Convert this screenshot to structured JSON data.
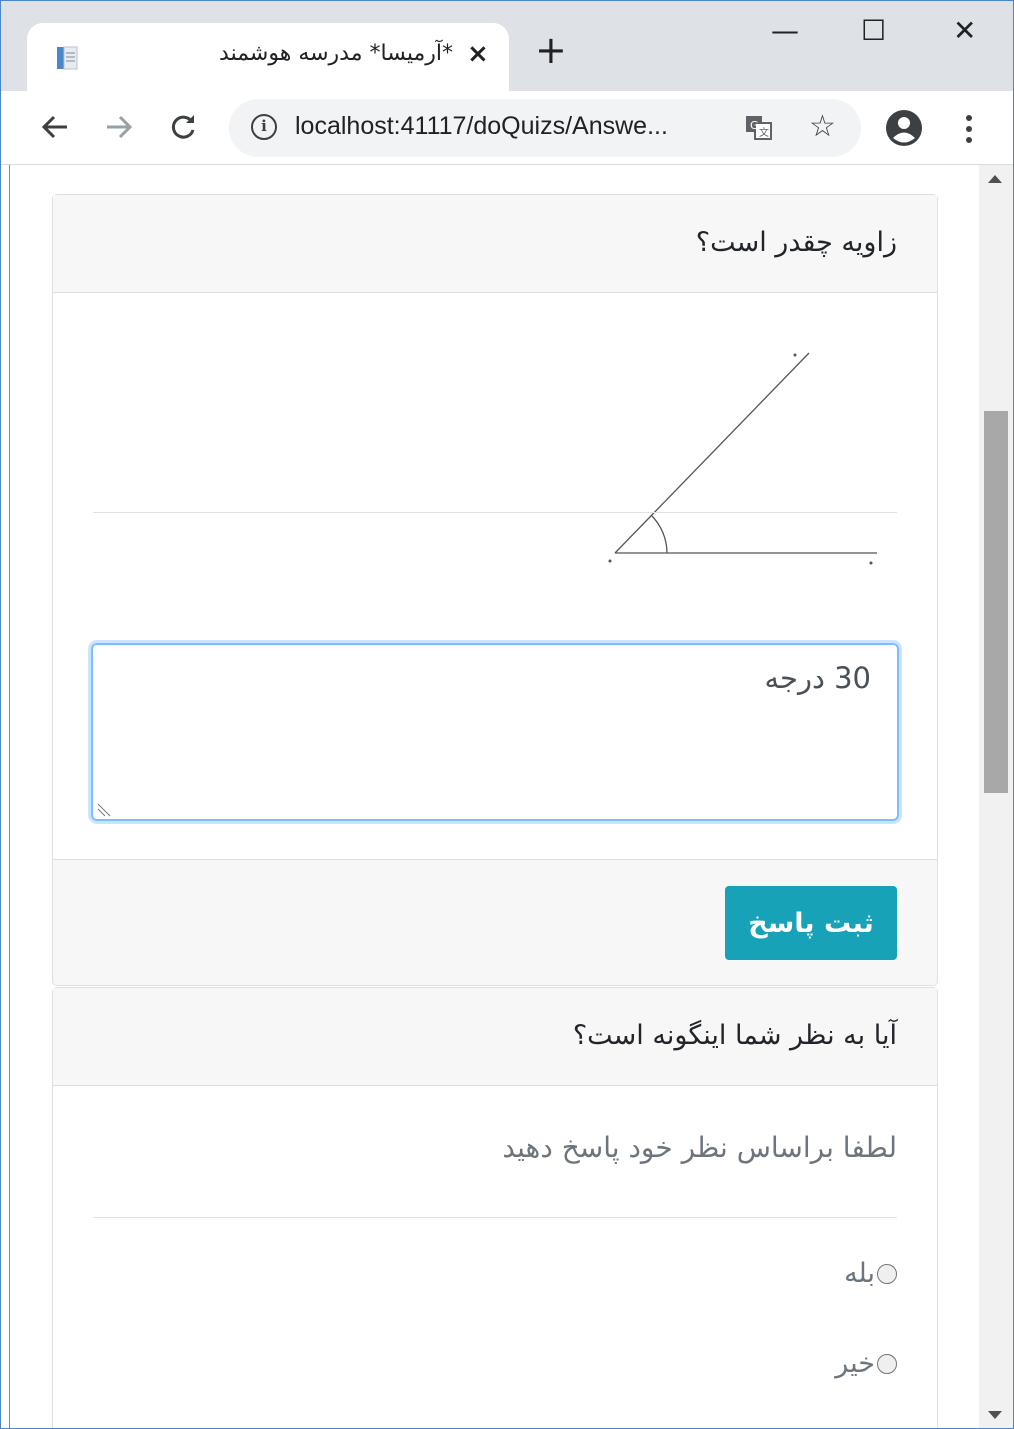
{
  "browser": {
    "tab_title": "*آرمیسا* مدرسه هوشمند",
    "tab_close": "×",
    "new_tab": "+",
    "url": "localhost:41117/doQuizs/Answe...",
    "controls": {
      "minimize": "—",
      "maximize": "☐",
      "close": "✕"
    }
  },
  "question1": {
    "title": "زاویه چقدر است؟",
    "answer_value": "30 درجه",
    "submit_label": "ثبت پاسخ"
  },
  "question2": {
    "title": "آیا به نظر شما اینگونه است؟",
    "hint": "لطفا براساس نظر خود پاسخ دهید",
    "options": [
      "بله",
      "خیر"
    ]
  },
  "colors": {
    "accent": "#17a2b8",
    "focus": "#80bdff"
  }
}
